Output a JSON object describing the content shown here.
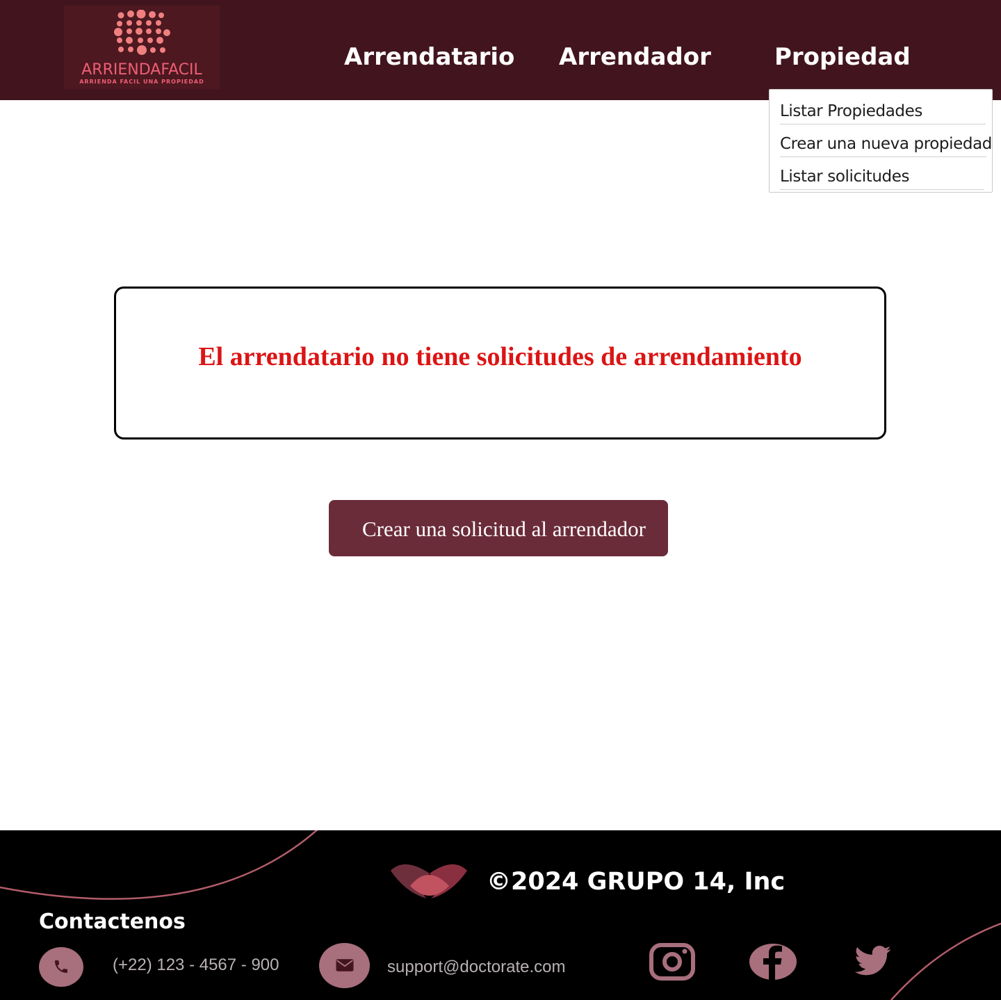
{
  "header": {
    "logo": {
      "name": "ARRIENDAFACIL",
      "tagline": "ARRIENDA FACIL UNA PROPIEDAD"
    },
    "nav": [
      {
        "label": "Arrendatario"
      },
      {
        "label": "Arrendador"
      },
      {
        "label": "Propiedad"
      }
    ]
  },
  "dropdown": {
    "items": [
      {
        "label": "Listar Propiedades"
      },
      {
        "label": "Crear una nueva propiedad"
      },
      {
        "label": "Listar solicitudes"
      }
    ]
  },
  "main": {
    "message": "El arrendatario no tiene solicitudes de arrendamiento",
    "cta_label": "Crear una solicitud al arrendador"
  },
  "footer": {
    "copyright": "©2024 GRUPO 14, Inc",
    "contact_title": "Contactenos",
    "phone": "(+22) 123 - 4567 - 900",
    "email": "support@doctorate.com",
    "icons": [
      "phone-icon",
      "mail-icon",
      "instagram-icon",
      "facebook-icon",
      "twitter-icon"
    ]
  },
  "colors": {
    "header_bg": "#42151e",
    "accent": "#6b2c39",
    "message": "#dc1414",
    "footer_bg": "#000000",
    "icon_bg": "#a86f7d"
  }
}
